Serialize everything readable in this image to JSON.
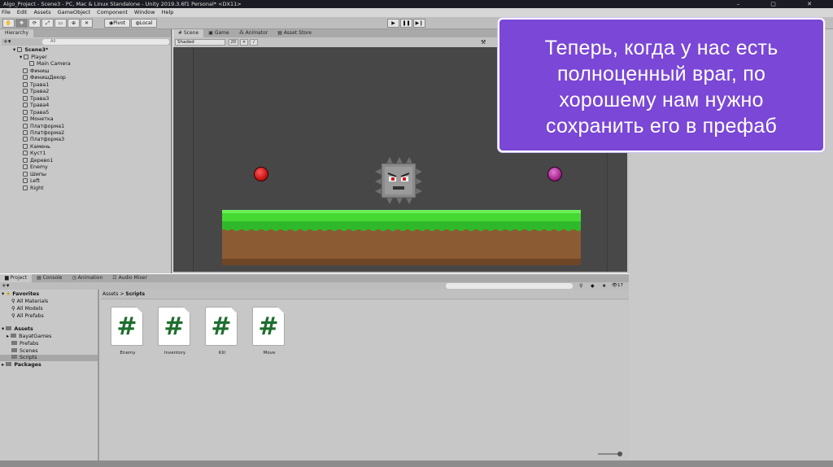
{
  "window": {
    "title": "Algo_Project - Scene3 - PC, Mac & Linux Standalone - Unity 2019.3.6f1 Personal* <DX11>",
    "controls": "–  ▢  ✕"
  },
  "menu": [
    "File",
    "Edit",
    "Assets",
    "GameObject",
    "Component",
    "Window",
    "Help"
  ],
  "toolbar": {
    "pivot": "Pivot",
    "local": "Local"
  },
  "hierarchy": {
    "tab": "Hierarchy",
    "search_placeholder": "All",
    "scene": "Scene3*",
    "items": [
      "Player",
      "Main Camera",
      "Финиш",
      "ФинишДекор",
      "Трава1",
      "Трава2",
      "Трава3",
      "Трава4",
      "Трава5",
      "Монетка",
      "Платформа1",
      "Платформа2",
      "Платформа3",
      "Камень",
      "Куст1",
      "Дерево1",
      "Enemy",
      "Шипы",
      "Left",
      "Right"
    ]
  },
  "scene_tabs": [
    "Scene",
    "Game",
    "Animator",
    "Asset Store"
  ],
  "scene_toolbar": {
    "shading": "Shaded",
    "mode": "2D"
  },
  "project": {
    "tabs": [
      "Project",
      "Console",
      "Animation",
      "Audio Mixer"
    ],
    "favorites": {
      "title": "Favorites",
      "items": [
        "All Materials",
        "All Models",
        "All Prefabs"
      ]
    },
    "assets": {
      "title": "Assets",
      "items": [
        "BayatGames",
        "Prefabs",
        "Scenes",
        "Scripts"
      ]
    },
    "packages": "Packages",
    "breadcrumb": {
      "root": "Assets",
      "sep": ">",
      "current": "Scripts"
    },
    "count": "17",
    "files": [
      "Enemy",
      "Inventory",
      "Kill",
      "Move"
    ]
  },
  "callout": {
    "lines": [
      "Теперь, когда у нас есть",
      "полноценный враг, по",
      "хорошему нам нужно",
      "сохранить его в префаб"
    ]
  },
  "colors": {
    "callout_bg": "#7a47d6",
    "grass": "#3fcc2e",
    "dirt": "#8a5a33",
    "coin_red": "#cc1f1f",
    "coin_purple": "#b0309a"
  }
}
